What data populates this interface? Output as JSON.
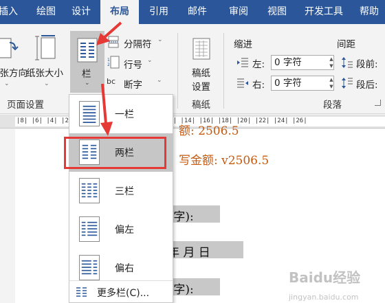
{
  "tabs": [
    {
      "label": "插入",
      "active": false
    },
    {
      "label": "绘图",
      "active": false
    },
    {
      "label": "设计",
      "active": false
    },
    {
      "label": "布局",
      "active": true
    },
    {
      "label": "引用",
      "active": false
    },
    {
      "label": "邮件",
      "active": false
    },
    {
      "label": "审阅",
      "active": false
    },
    {
      "label": "视图",
      "active": false
    },
    {
      "label": "开发工具",
      "active": false
    },
    {
      "label": "帮助",
      "active": false
    }
  ],
  "page_setup": {
    "orientation_label": "纸张方向",
    "size_label": "纸张大小",
    "columns_label": "栏",
    "breaks_label": "分隔符",
    "line_numbers_label": "行号",
    "hyphenation_label": "断字",
    "group_label": "页面设置"
  },
  "manuscript": {
    "label_line1": "稿纸",
    "label_line2": "设置",
    "group_label": "稿纸"
  },
  "paragraph": {
    "indent_title": "缩进",
    "spacing_title": "间距",
    "left_label": "左:",
    "right_label": "右:",
    "left_value": "0 字符",
    "right_value": "0 字符",
    "before_label": "段前:",
    "after_label": "段后:",
    "group_label": "段落"
  },
  "columns_menu": {
    "items": [
      {
        "label": "一栏",
        "icon": "one-column-icon",
        "highlighted": false
      },
      {
        "label": "两栏",
        "icon": "two-columns-icon",
        "highlighted": true
      },
      {
        "label": "三栏",
        "icon": "three-columns-icon",
        "highlighted": false
      },
      {
        "label": "偏左",
        "icon": "left-column-icon",
        "highlighted": false
      },
      {
        "label": "偏右",
        "icon": "right-column-icon",
        "highlighted": false
      }
    ],
    "more_label": "更多栏(C)..."
  },
  "document": {
    "line1": "额: 2506.5",
    "line2": "写金额: v2506.5",
    "line3": "E字):",
    "line4": "年  月  日",
    "line5": "E字):"
  },
  "ruler_marks": "|8|  |6|  |4|  |2|  |  |2|  |4|  |6|  |8|  |10|  |12|  |14|  |16|  |18|  |20|  |22|  |24|  |26|",
  "watermark": {
    "main": "Baidu经验",
    "sub": "jingyan.baidu.com"
  },
  "colors": {
    "ribbon_blue": "#2b579a",
    "document_text": "#c55a11",
    "highlight": "#c8c8c8",
    "annotation_red": "#e53935"
  }
}
